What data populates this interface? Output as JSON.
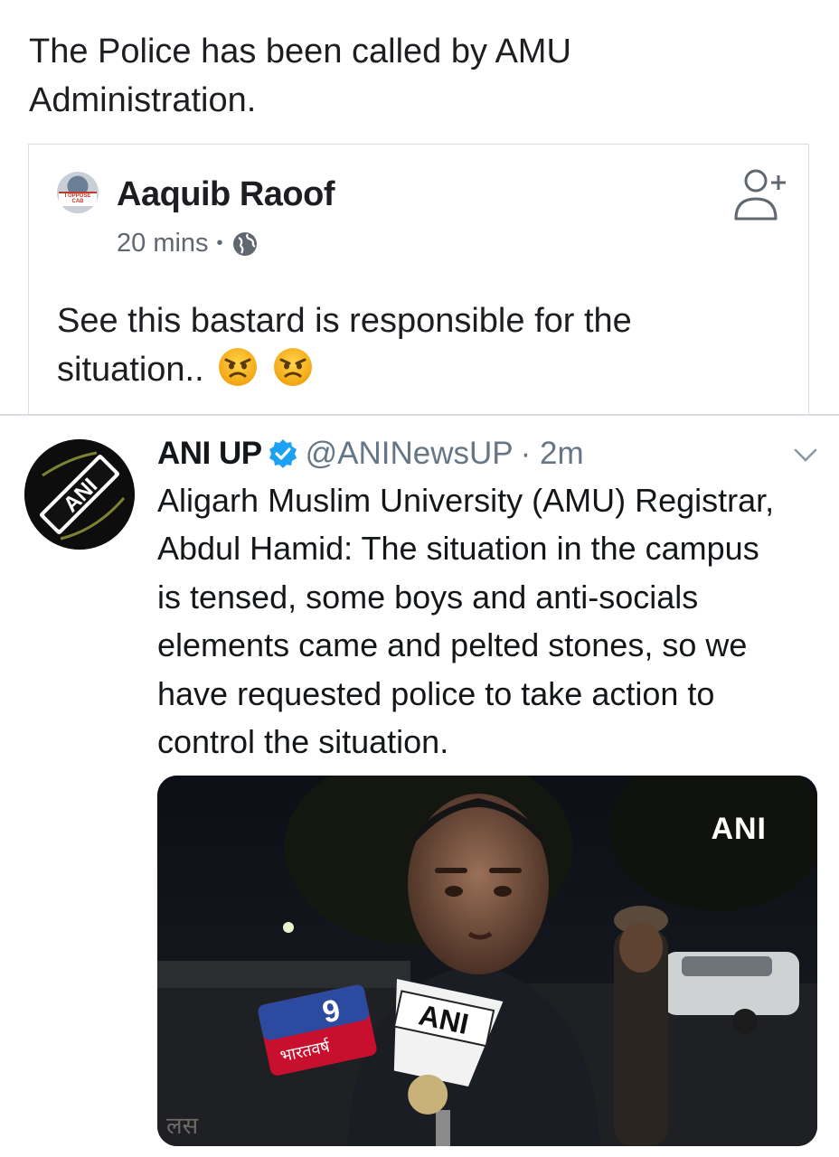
{
  "caption": {
    "line1": "The Police has been called by AMU",
    "line2": "Administration."
  },
  "fb_post": {
    "author": "Aaquib Raoof",
    "avatar_badge_line1": "I OPPOSE",
    "avatar_badge_line2": "CAB",
    "time": "20 mins",
    "separator": "•",
    "privacy_icon": "globe-icon",
    "add_friend_icon": "add-friend-icon",
    "text_line1": "See this bastard is responsible for the",
    "text_line2": "situation..",
    "emoji_icon": "angry-face-emoji"
  },
  "tweet": {
    "name": "ANI UP",
    "verified_icon": "verified-badge-icon",
    "handle": "@ANINewsUP",
    "time": "· 2m",
    "avatar_logo": "ANI",
    "menu_icon": "chevron-down-icon",
    "text": [
      "Aligarh Muslim University (AMU) Registrar,",
      "Abdul Hamid: The situation in the campus",
      "is tensed, some boys and anti-socials",
      "elements came and pelted stones, so we",
      "have requested police to take action to",
      "control the situation."
    ],
    "media": {
      "watermark": "ANI",
      "mic_label_1": "ANI",
      "mic_label_2": "9",
      "mic_label_2_sub": "भारतवर्ष",
      "corner_text": "लस"
    }
  },
  "colors": {
    "text": "#1c1e21",
    "meta_gray": "#606770",
    "twitter_blue": "#1da1f2",
    "handle_gray": "#657786",
    "divider": "#dadde1"
  }
}
